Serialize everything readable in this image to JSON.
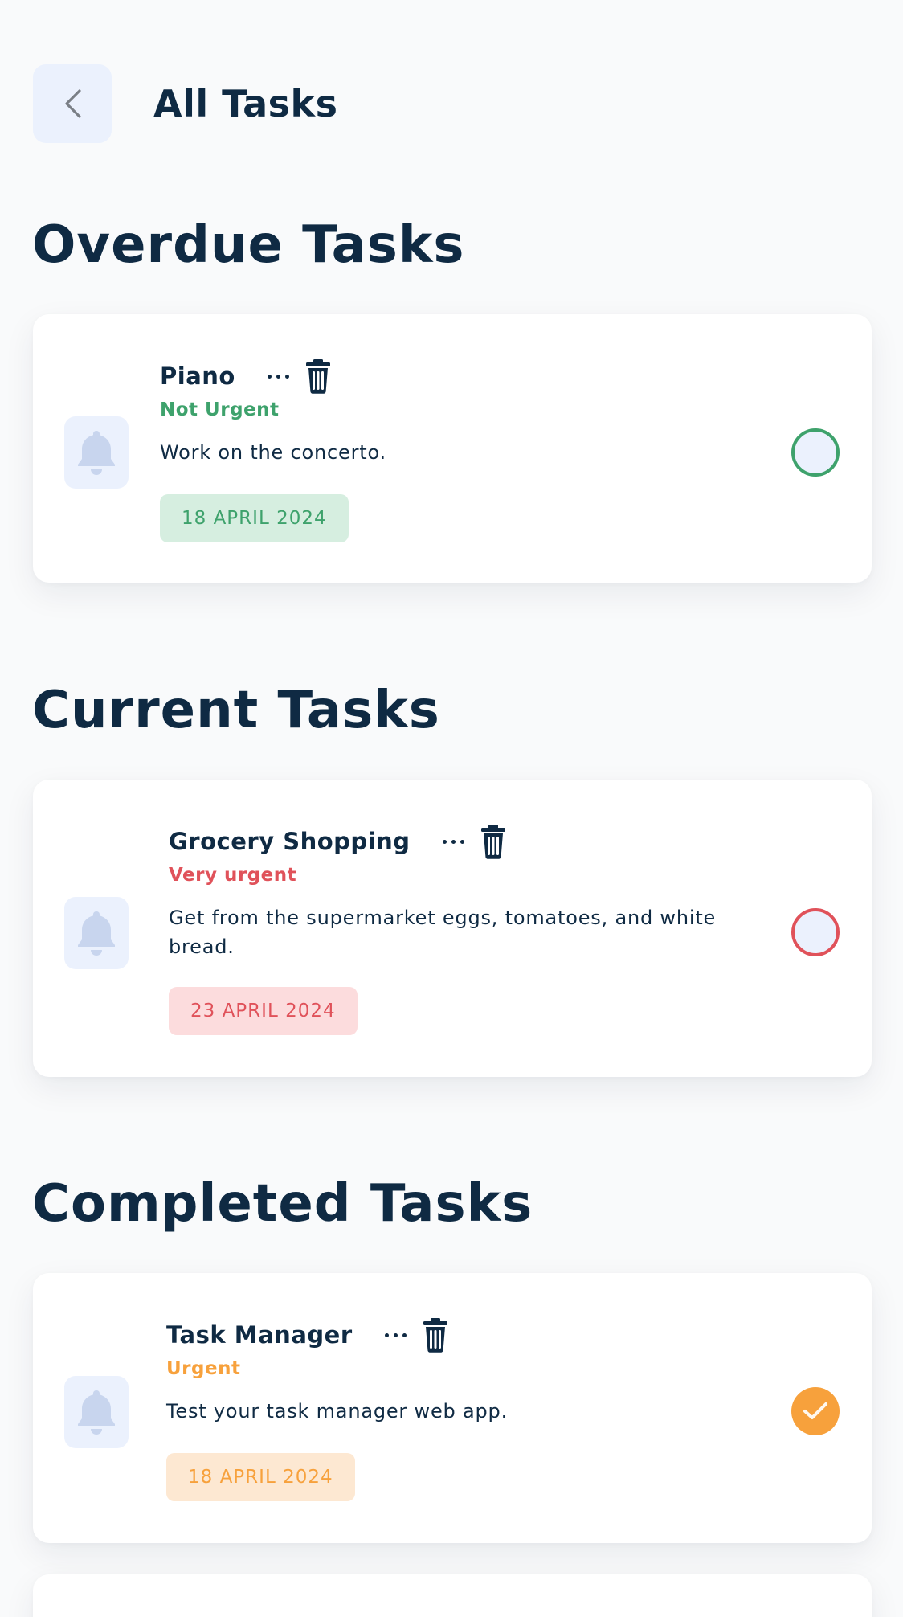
{
  "header": {
    "title": "All Tasks"
  },
  "sections": {
    "overdue": {
      "title": "Overdue Tasks"
    },
    "current": {
      "title": "Current Tasks"
    },
    "completed": {
      "title": "Completed Tasks"
    }
  },
  "tasks": {
    "piano": {
      "title": "Piano",
      "priority": "Not Urgent",
      "description": "Work on the concerto.",
      "date": "18 APRIL 2024",
      "status": "incomplete",
      "accent": "#3ea26c"
    },
    "grocery": {
      "title": "Grocery Shopping",
      "priority": "Very urgent",
      "description": "Get from the supermarket eggs, tomatoes, and white bread.",
      "date": "23 APRIL 2024",
      "status": "incomplete",
      "accent": "#e0525a"
    },
    "taskmanager": {
      "title": "Task Manager",
      "priority": "Urgent",
      "description": "Test your task manager web app.",
      "date": "18 APRIL 2024",
      "status": "completed",
      "accent": "#f7a13c"
    }
  },
  "colors": {
    "text_dark": "#0f2a43",
    "icon_bg": "#ebf1fd",
    "bell": "#c8d5ee",
    "green": "#3ea26c",
    "green_bg": "#d6eee0",
    "red": "#e0525a",
    "red_bg": "#fcdcdd",
    "orange": "#f7a13c",
    "orange_bg": "#fde8d2"
  },
  "icons": {
    "back": "chevron-left-icon",
    "bell": "bell-icon",
    "more": "more-horizontal-icon",
    "trash": "trash-icon",
    "check": "check-icon"
  }
}
